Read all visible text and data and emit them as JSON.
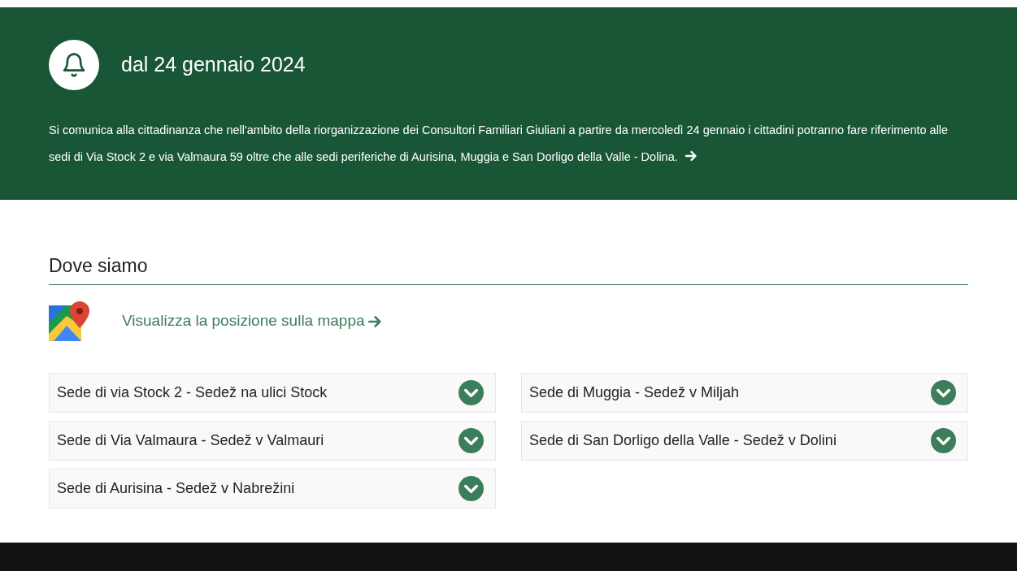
{
  "notice": {
    "title": "dal 24 gennaio 2024",
    "text": "Si comunica alla cittadinanza che nell'ambito della riorganizzazione dei Consultori Familiari Giuliani a partire da mercoledì 24 gennaio i cittadini potranno fare riferimento alle sedi di Via Stock 2 e via Valmaura 59 oltre che alle sedi periferiche di Aurisina, Muggia e San Dorligo della Valle - Dolina."
  },
  "section": {
    "title": "Dove siamo",
    "map_link": "Visualizza la posizione sulla mappa"
  },
  "locations": [
    {
      "label": "Sede di via Stock 2 - Sedež na ulici Stock",
      "expanded": false
    },
    {
      "label": "Sede di Via Valmaura - Sedež v Valmauri",
      "expanded": false
    },
    {
      "label": "Sede di Aurisina - Sedež v Nabrežini",
      "expanded": false
    },
    {
      "label": "Sede di Muggia - Sedež v Miljah",
      "expanded": false
    },
    {
      "label": "Sede di San Dorligo della Valle - Sedež v Dolini",
      "expanded": false
    }
  ]
}
